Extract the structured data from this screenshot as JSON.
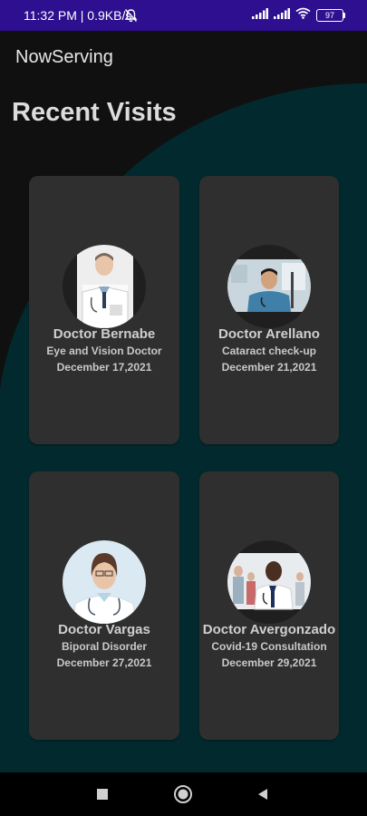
{
  "status_bar": {
    "time_speed": "11:32 PM | 0.9KB/s",
    "battery": "97",
    "icons": [
      "bell-off-icon",
      "cell-signal-icon",
      "cell-signal-icon",
      "wifi-icon",
      "battery-icon"
    ]
  },
  "app": {
    "title": "NowServing"
  },
  "main": {
    "heading": "Recent Visits",
    "visits": [
      {
        "name": "Doctor Bernabe",
        "description": "Eye and Vision Doctor",
        "date": "December 17,2021"
      },
      {
        "name": "Doctor Arellano",
        "description": "Cataract check-up",
        "date": "December 21,2021"
      },
      {
        "name": "Doctor Vargas",
        "description": "Biporal Disorder",
        "date": "December 27,2021"
      },
      {
        "name": "Doctor Avergonzado",
        "description": "Covid-19 Consultation",
        "date": "December 29,2021"
      }
    ]
  },
  "nav_bar": {
    "icons": [
      "recents-square-icon",
      "home-circle-icon",
      "back-triangle-icon"
    ]
  },
  "colors": {
    "status_bar": "#2d0f8f",
    "background": "#101010",
    "wave": "#022a2e",
    "card": "#2f2f2f"
  }
}
